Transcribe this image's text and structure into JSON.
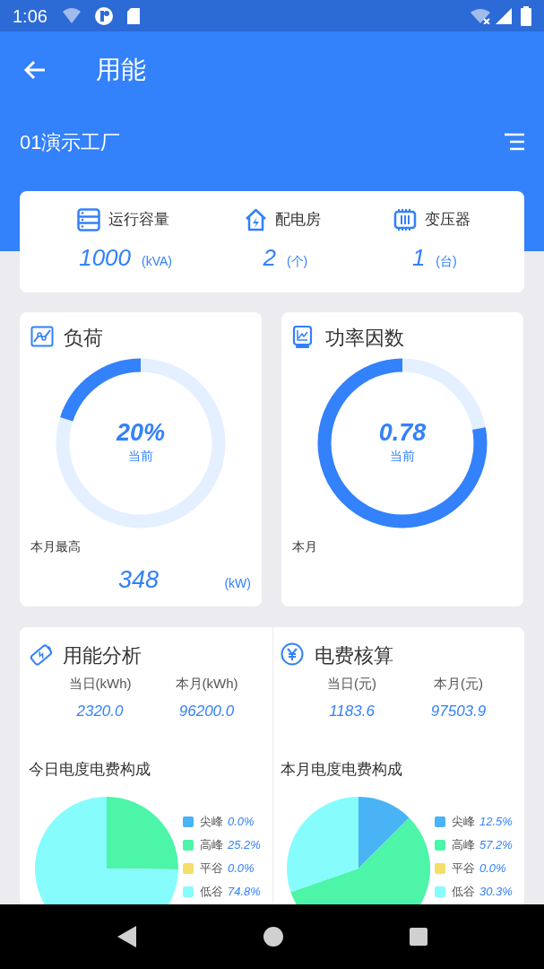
{
  "status_bar": {
    "time": "1:06"
  },
  "header": {
    "title": "用能"
  },
  "site": {
    "name": "01演示工厂"
  },
  "summary": [
    {
      "label": "运行容量",
      "value": "1000",
      "unit": "(kVA)"
    },
    {
      "label": "配电房",
      "value": "2",
      "unit": "(个)"
    },
    {
      "label": "变压器",
      "value": "1",
      "unit": "(台)"
    }
  ],
  "gauges": [
    {
      "title": "负荷",
      "value": "20%",
      "caption": "当前",
      "level": 0.2,
      "footer_label": "本月最高",
      "footer_value": "348",
      "footer_unit": "(kW)"
    },
    {
      "title": "功率因数",
      "value": "0.78",
      "caption": "当前",
      "level": 0.78,
      "footer_label": "本月"
    }
  ],
  "analysis": [
    {
      "title": "用能分析",
      "metrics": [
        {
          "label": "当日(kWh)",
          "value": "2320.0"
        },
        {
          "label": "本月(kWh)",
          "value": "96200.0"
        }
      ],
      "chart_title": "今日电度电费构成",
      "slices": [
        {
          "color": "#4ab3f5"
        },
        {
          "color": "#4cf5a8"
        },
        {
          "color": "#f5de6a"
        },
        {
          "color": "#87fcfd"
        }
      ],
      "chart_data": {
        "type": "pie",
        "legend": "right",
        "categories": [
          "尖峰",
          "高峰",
          "平谷",
          "低谷"
        ],
        "values": [
          0,
          25.2,
          0,
          74.8
        ],
        "value_labels": [
          "0.0%",
          "25.2%",
          "0.0%",
          "74.8%"
        ]
      }
    },
    {
      "title": "电费核算",
      "metrics": [
        {
          "label": "当日(元)",
          "value": "1183.6"
        },
        {
          "label": "本月(元)",
          "value": "97503.9"
        }
      ],
      "chart_title": "本月电度电费构成",
      "slices": [
        {
          "color": "#4ab3f5"
        },
        {
          "color": "#4cf5a8"
        },
        {
          "color": "#f5de6a"
        },
        {
          "color": "#87fcfd"
        }
      ],
      "chart_data": {
        "type": "pie",
        "legend": "right",
        "categories": [
          "尖峰",
          "高峰",
          "平谷",
          "低谷"
        ],
        "values": [
          12.5,
          57.2,
          0,
          30.3
        ],
        "value_labels": [
          "12.5%",
          "57.2%",
          "0.0%",
          "30.3%"
        ]
      }
    }
  ]
}
